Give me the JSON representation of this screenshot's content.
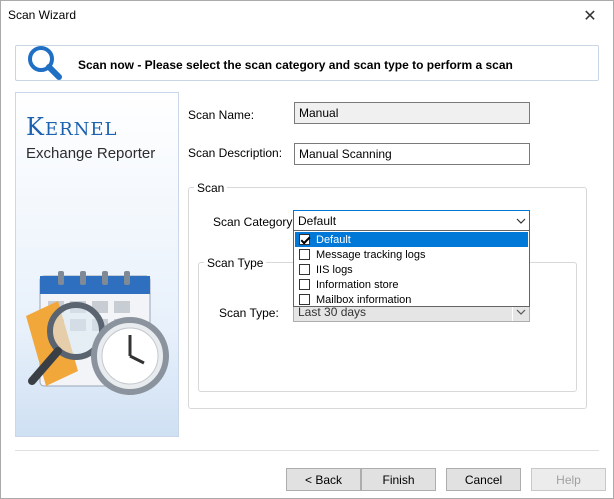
{
  "window": {
    "title": "Scan Wizard",
    "close_glyph": "✕"
  },
  "header": {
    "text": "Scan now - Please select the scan category and scan type to perform a scan",
    "icon": "search-icon"
  },
  "brand": {
    "name": "Kernel",
    "product": "Exchange Reporter"
  },
  "form": {
    "scan_name_label": "Scan Name:",
    "scan_name_value": "Manual",
    "scan_description_label": "Scan Description:",
    "scan_description_value": "Manual Scanning",
    "scan_group_title": "Scan",
    "scan_category_label": "Scan Category:",
    "scan_category_value": "Default",
    "scan_type_group_title": "Scan Type",
    "scan_type_label": "Scan Type:",
    "scan_type_value": "Last 30 days"
  },
  "category_options": [
    {
      "label": "Default",
      "checked": true,
      "selected": true
    },
    {
      "label": "Message tracking logs",
      "checked": false,
      "selected": false
    },
    {
      "label": "IIS logs",
      "checked": false,
      "selected": false
    },
    {
      "label": "Information store",
      "checked": false,
      "selected": false
    },
    {
      "label": "Mailbox information",
      "checked": false,
      "selected": false
    }
  ],
  "buttons": {
    "back": "< Back",
    "finish": "Finish",
    "cancel": "Cancel",
    "help": "Help"
  },
  "colors": {
    "accent": "#0078d7",
    "brand": "#1d62b0"
  }
}
